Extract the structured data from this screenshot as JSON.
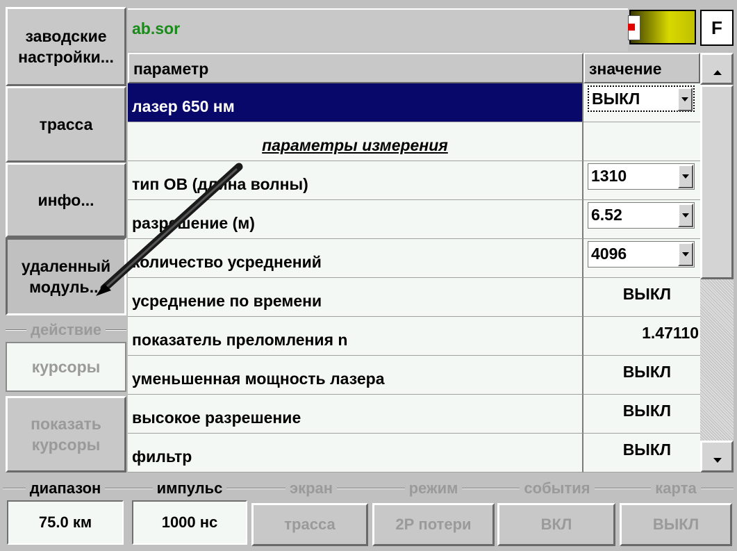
{
  "left_buttons": {
    "factory": "заводские\nнастройки...",
    "trace": "трасса",
    "info": "инфо...",
    "remote": "удаленный\nмодуль...",
    "action_group": "действие",
    "cursors": "курсоры",
    "show_cursors": "показать\nкурсоры"
  },
  "header": {
    "filename": "ab.sor",
    "f_button": "F"
  },
  "table": {
    "col_param": "параметр",
    "col_value": "значение",
    "rows": [
      {
        "param": "лазер 650 нм",
        "value": "ВЫКЛ"
      },
      {
        "section": "параметры измерения"
      },
      {
        "param": "тип ОВ (длина волны)",
        "value": "1310"
      },
      {
        "param": "разрешение (м)",
        "value": "6.52"
      },
      {
        "param": "количество усреднений",
        "value": "4096"
      },
      {
        "param": "усреднение по времени",
        "value": "ВЫКЛ"
      },
      {
        "param": "показатель преломления n",
        "value": "1.47110"
      },
      {
        "param": "уменьшенная мощность лазера",
        "value": "ВЫКЛ"
      },
      {
        "param": "высокое разрешение",
        "value": "ВЫКЛ"
      },
      {
        "param": "фильтр",
        "value": "ВЫКЛ"
      }
    ]
  },
  "bottom": {
    "range_label": "диапазон",
    "range_value": "75.0 км",
    "pulse_label": "импульс",
    "pulse_value": "1000 нс",
    "screen_label": "экран",
    "screen_value": "трасса",
    "mode_label": "режим",
    "mode_value": "2Р потери",
    "events_label": "события",
    "events_value": "ВКЛ",
    "map_label": "карта",
    "map_value": "ВЫКЛ"
  },
  "colors": {
    "selected_row": "#08086a",
    "filename": "#1a8a1a",
    "cell_bg": "#f4f8f4",
    "battery": "#c8c800"
  }
}
